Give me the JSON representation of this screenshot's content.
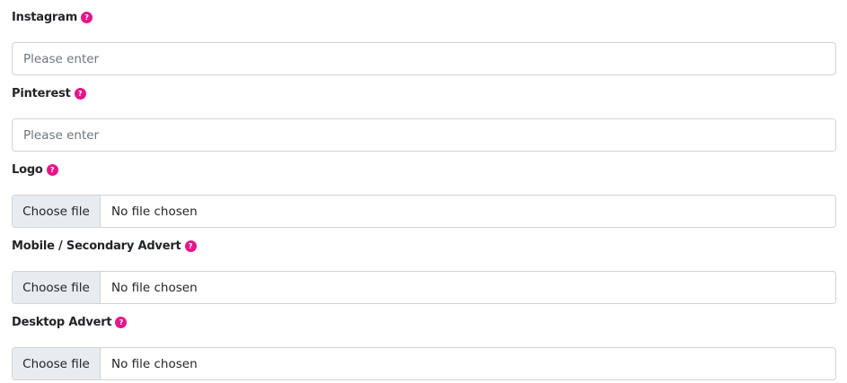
{
  "fields": [
    {
      "label": "Instagram",
      "type": "text",
      "placeholder": "Please enter",
      "help": "?"
    },
    {
      "label": "Pinterest",
      "type": "text",
      "placeholder": "Please enter",
      "help": "?"
    },
    {
      "label": "Logo",
      "type": "file",
      "button": "Choose file",
      "status": "No file chosen",
      "help": "?"
    },
    {
      "label": "Mobile / Secondary Advert",
      "type": "file",
      "button": "Choose file",
      "status": "No file chosen",
      "help": "?"
    },
    {
      "label": "Desktop Advert",
      "type": "file",
      "button": "Choose file",
      "status": "No file chosen",
      "help": "?"
    }
  ],
  "colors": {
    "accent": "#e5168a",
    "border": "#ced4da",
    "file_button_bg": "#e9ecef",
    "label_text": "#212529",
    "placeholder_text": "#6c757d"
  },
  "icons": {
    "help": "help-icon"
  }
}
